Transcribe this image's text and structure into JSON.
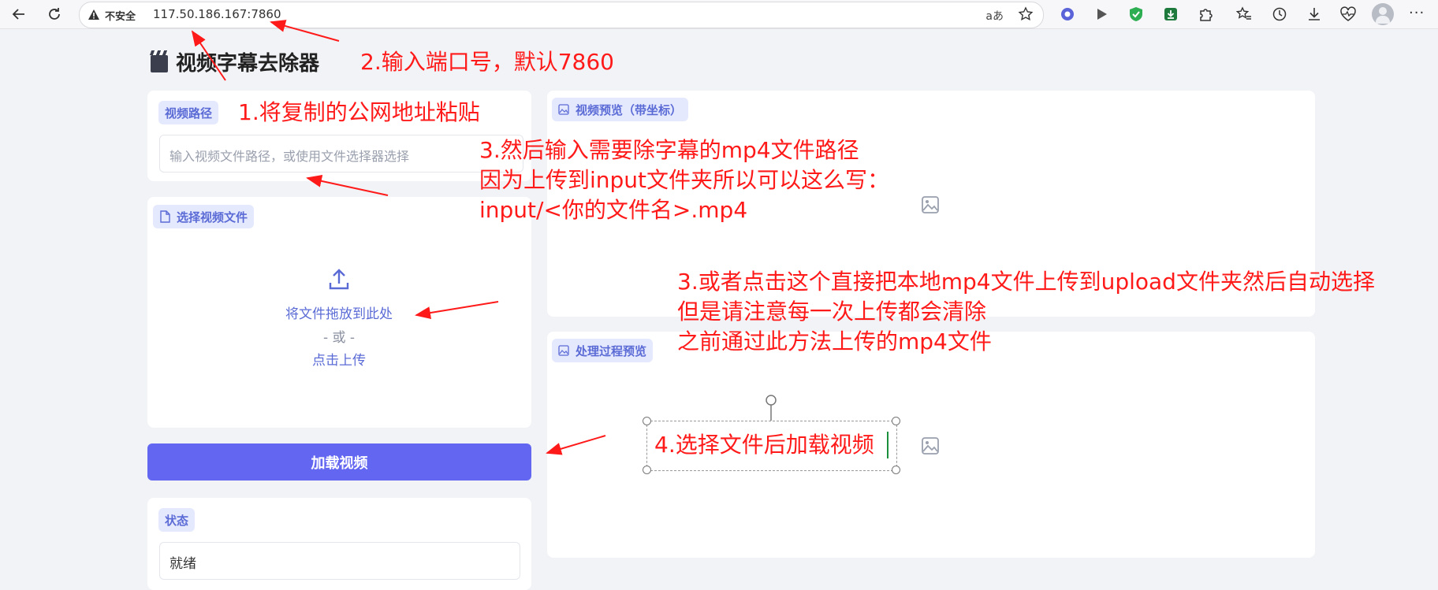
{
  "browser": {
    "insecure_label": "不安全",
    "url": "117.50.186.167:7860",
    "read_aloud_label": "aあ"
  },
  "app": {
    "title": "视频字幕去除器",
    "video_path": {
      "label": "视频路径",
      "placeholder": "输入视频文件路径，或使用文件选择器选择"
    },
    "file_picker": {
      "label": "选择视频文件",
      "drop_text": "将文件拖放到此处",
      "or_text": "- 或 -",
      "click_text": "点击上传"
    },
    "load_button": "加载视频",
    "status": {
      "label": "状态",
      "value": "就绪"
    },
    "preview": {
      "label": "视频预览（带坐标）"
    },
    "process_preview": {
      "label": "处理过程预览"
    }
  },
  "annotations": {
    "a1": "1.将复制的公网地址粘贴",
    "a2": "2.输入端口号，默认7860",
    "a3_line1": "3.然后输入需要除字幕的mp4文件路径",
    "a3_line2": "因为上传到input文件夹所以可以这么写：",
    "a3_line3": "input/<你的文件名>.mp4",
    "a3b_line1": "3.或者点击这个直接把本地mp4文件上传到upload文件夹然后自动选择",
    "a3b_line2": "但是请注意每一次上传都会清除",
    "a3b_line3": "之前通过此方法上传的mp4文件",
    "a4": "4.选择文件后加载视频"
  },
  "colors": {
    "accent": "#6366f1",
    "chip_bg": "#e5e9fd",
    "chip_text": "#5b6bd6",
    "annotation": "#ff1a1a"
  }
}
